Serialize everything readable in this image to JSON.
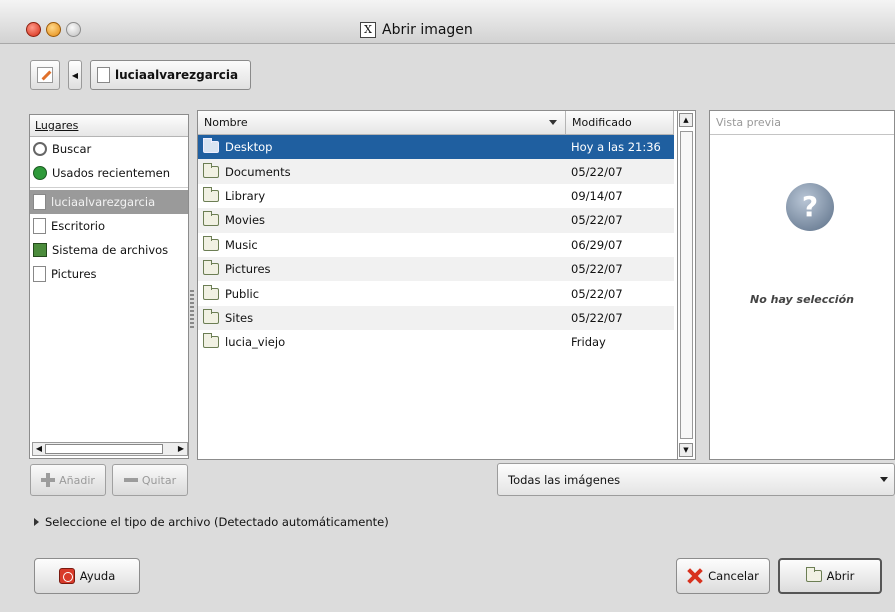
{
  "window": {
    "title": "Abrir imagen"
  },
  "pathbar": {
    "current": "luciaalvarezgarcia"
  },
  "places": {
    "header": "Lugares",
    "items": [
      {
        "label": "Buscar",
        "icon": "search-icon"
      },
      {
        "label": "Usados recientemen",
        "icon": "recent-icon"
      },
      {
        "label": "luciaalvarezgarcia",
        "icon": "home-folder-icon",
        "selected": true
      },
      {
        "label": "Escritorio",
        "icon": "document-icon"
      },
      {
        "label": "Sistema de archivos",
        "icon": "filesystem-icon"
      },
      {
        "label": "Pictures",
        "icon": "document-icon"
      }
    ],
    "add_label": "Añadir",
    "remove_label": "Quitar"
  },
  "files": {
    "col_name": "Nombre",
    "col_modified": "Modificado",
    "rows": [
      {
        "name": "Desktop",
        "modified": "Hoy a las 21:36",
        "selected": true
      },
      {
        "name": "Documents",
        "modified": "05/22/07"
      },
      {
        "name": "Library",
        "modified": "09/14/07"
      },
      {
        "name": "Movies",
        "modified": "05/22/07"
      },
      {
        "name": "Music",
        "modified": "06/29/07"
      },
      {
        "name": "Pictures",
        "modified": "05/22/07"
      },
      {
        "name": "Public",
        "modified": "05/22/07"
      },
      {
        "name": "Sites",
        "modified": "05/22/07"
      },
      {
        "name": "lucia_viejo",
        "modified": "Friday"
      }
    ]
  },
  "preview": {
    "header": "Vista previa",
    "empty_text": "No hay selección"
  },
  "filter": {
    "selected": "Todas las imágenes"
  },
  "expander": {
    "label": "Seleccione el tipo de archivo (Detectado automáticamente)"
  },
  "buttons": {
    "help": "Ayuda",
    "cancel": "Cancelar",
    "open": "Abrir"
  },
  "colors": {
    "selection": "#1f5fa0",
    "places_selection": "#9a9a9a"
  }
}
